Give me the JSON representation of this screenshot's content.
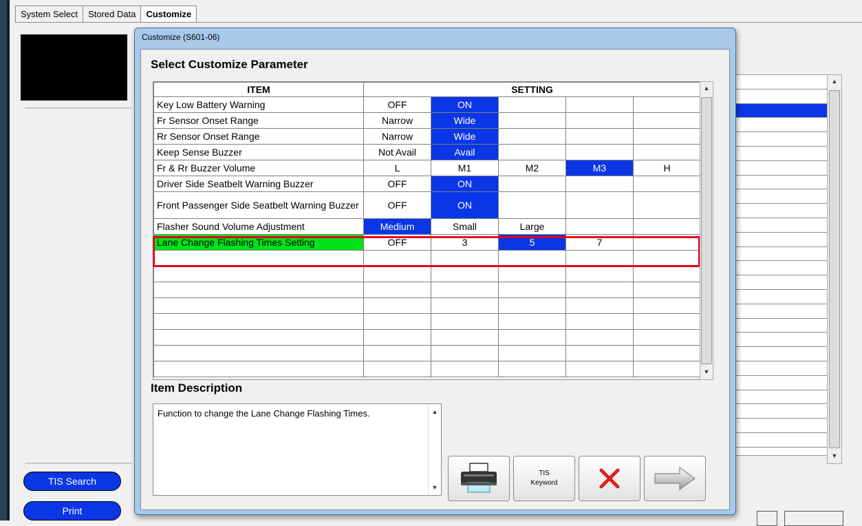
{
  "tabs": [
    {
      "label": "System Select",
      "active": false
    },
    {
      "label": "Stored Data",
      "active": false
    },
    {
      "label": "Customize",
      "active": true
    }
  ],
  "sidebar": {
    "tis_search_label": "TIS Search",
    "print_label": "Print"
  },
  "dialog": {
    "title": "Customize (S601-06)",
    "select_heading": "Select Customize Parameter",
    "columns": {
      "item": "ITEM",
      "setting": "SETTING"
    },
    "rows": [
      {
        "item": "Key Low Battery Warning",
        "settings": [
          "OFF",
          "ON",
          "",
          "",
          ""
        ],
        "selected_index": 1
      },
      {
        "item": "Fr Sensor Onset Range",
        "settings": [
          "Narrow",
          "Wide",
          "",
          "",
          ""
        ],
        "selected_index": 1
      },
      {
        "item": "Rr Sensor Onset Range",
        "settings": [
          "Narrow",
          "Wide",
          "",
          "",
          ""
        ],
        "selected_index": 1
      },
      {
        "item": "Keep Sense Buzzer",
        "settings": [
          "Not Avail",
          "Avail",
          "",
          "",
          ""
        ],
        "selected_index": 1
      },
      {
        "item": "Fr & Rr Buzzer Volume",
        "settings": [
          "L",
          "M1",
          "M2",
          "M3",
          "H"
        ],
        "selected_index": 3
      },
      {
        "item": "Driver Side Seatbelt Warning Buzzer",
        "settings": [
          "OFF",
          "ON",
          "",
          "",
          ""
        ],
        "selected_index": 1
      },
      {
        "item": "Front Passenger Side Seatbelt Warning Buzzer",
        "settings": [
          "OFF",
          "ON",
          "",
          "",
          ""
        ],
        "selected_index": 1
      },
      {
        "item": "Flasher Sound Volume Adjustment",
        "settings": [
          "Medium",
          "Small",
          "Large",
          "",
          ""
        ],
        "selected_index": 0
      },
      {
        "item": "Lane Change Flashing Times Setting",
        "settings": [
          "OFF",
          "3",
          "5",
          "7",
          ""
        ],
        "selected_index": 2,
        "highlighted": true
      }
    ],
    "empty_rows": 8,
    "description_heading": "Item Description",
    "description_text": "Function to change the Lane Change Flashing Times.",
    "tis_keyword": {
      "line1": "TIS",
      "line2": "Keyword"
    }
  },
  "colors": {
    "selected_setting": "#0b36e6",
    "highlighted_item": "#00e31a",
    "focus_frame": "#e0001b"
  },
  "icons": {
    "print": "printer-icon",
    "cancel": "red-x-icon",
    "next": "right-arrow-icon"
  }
}
